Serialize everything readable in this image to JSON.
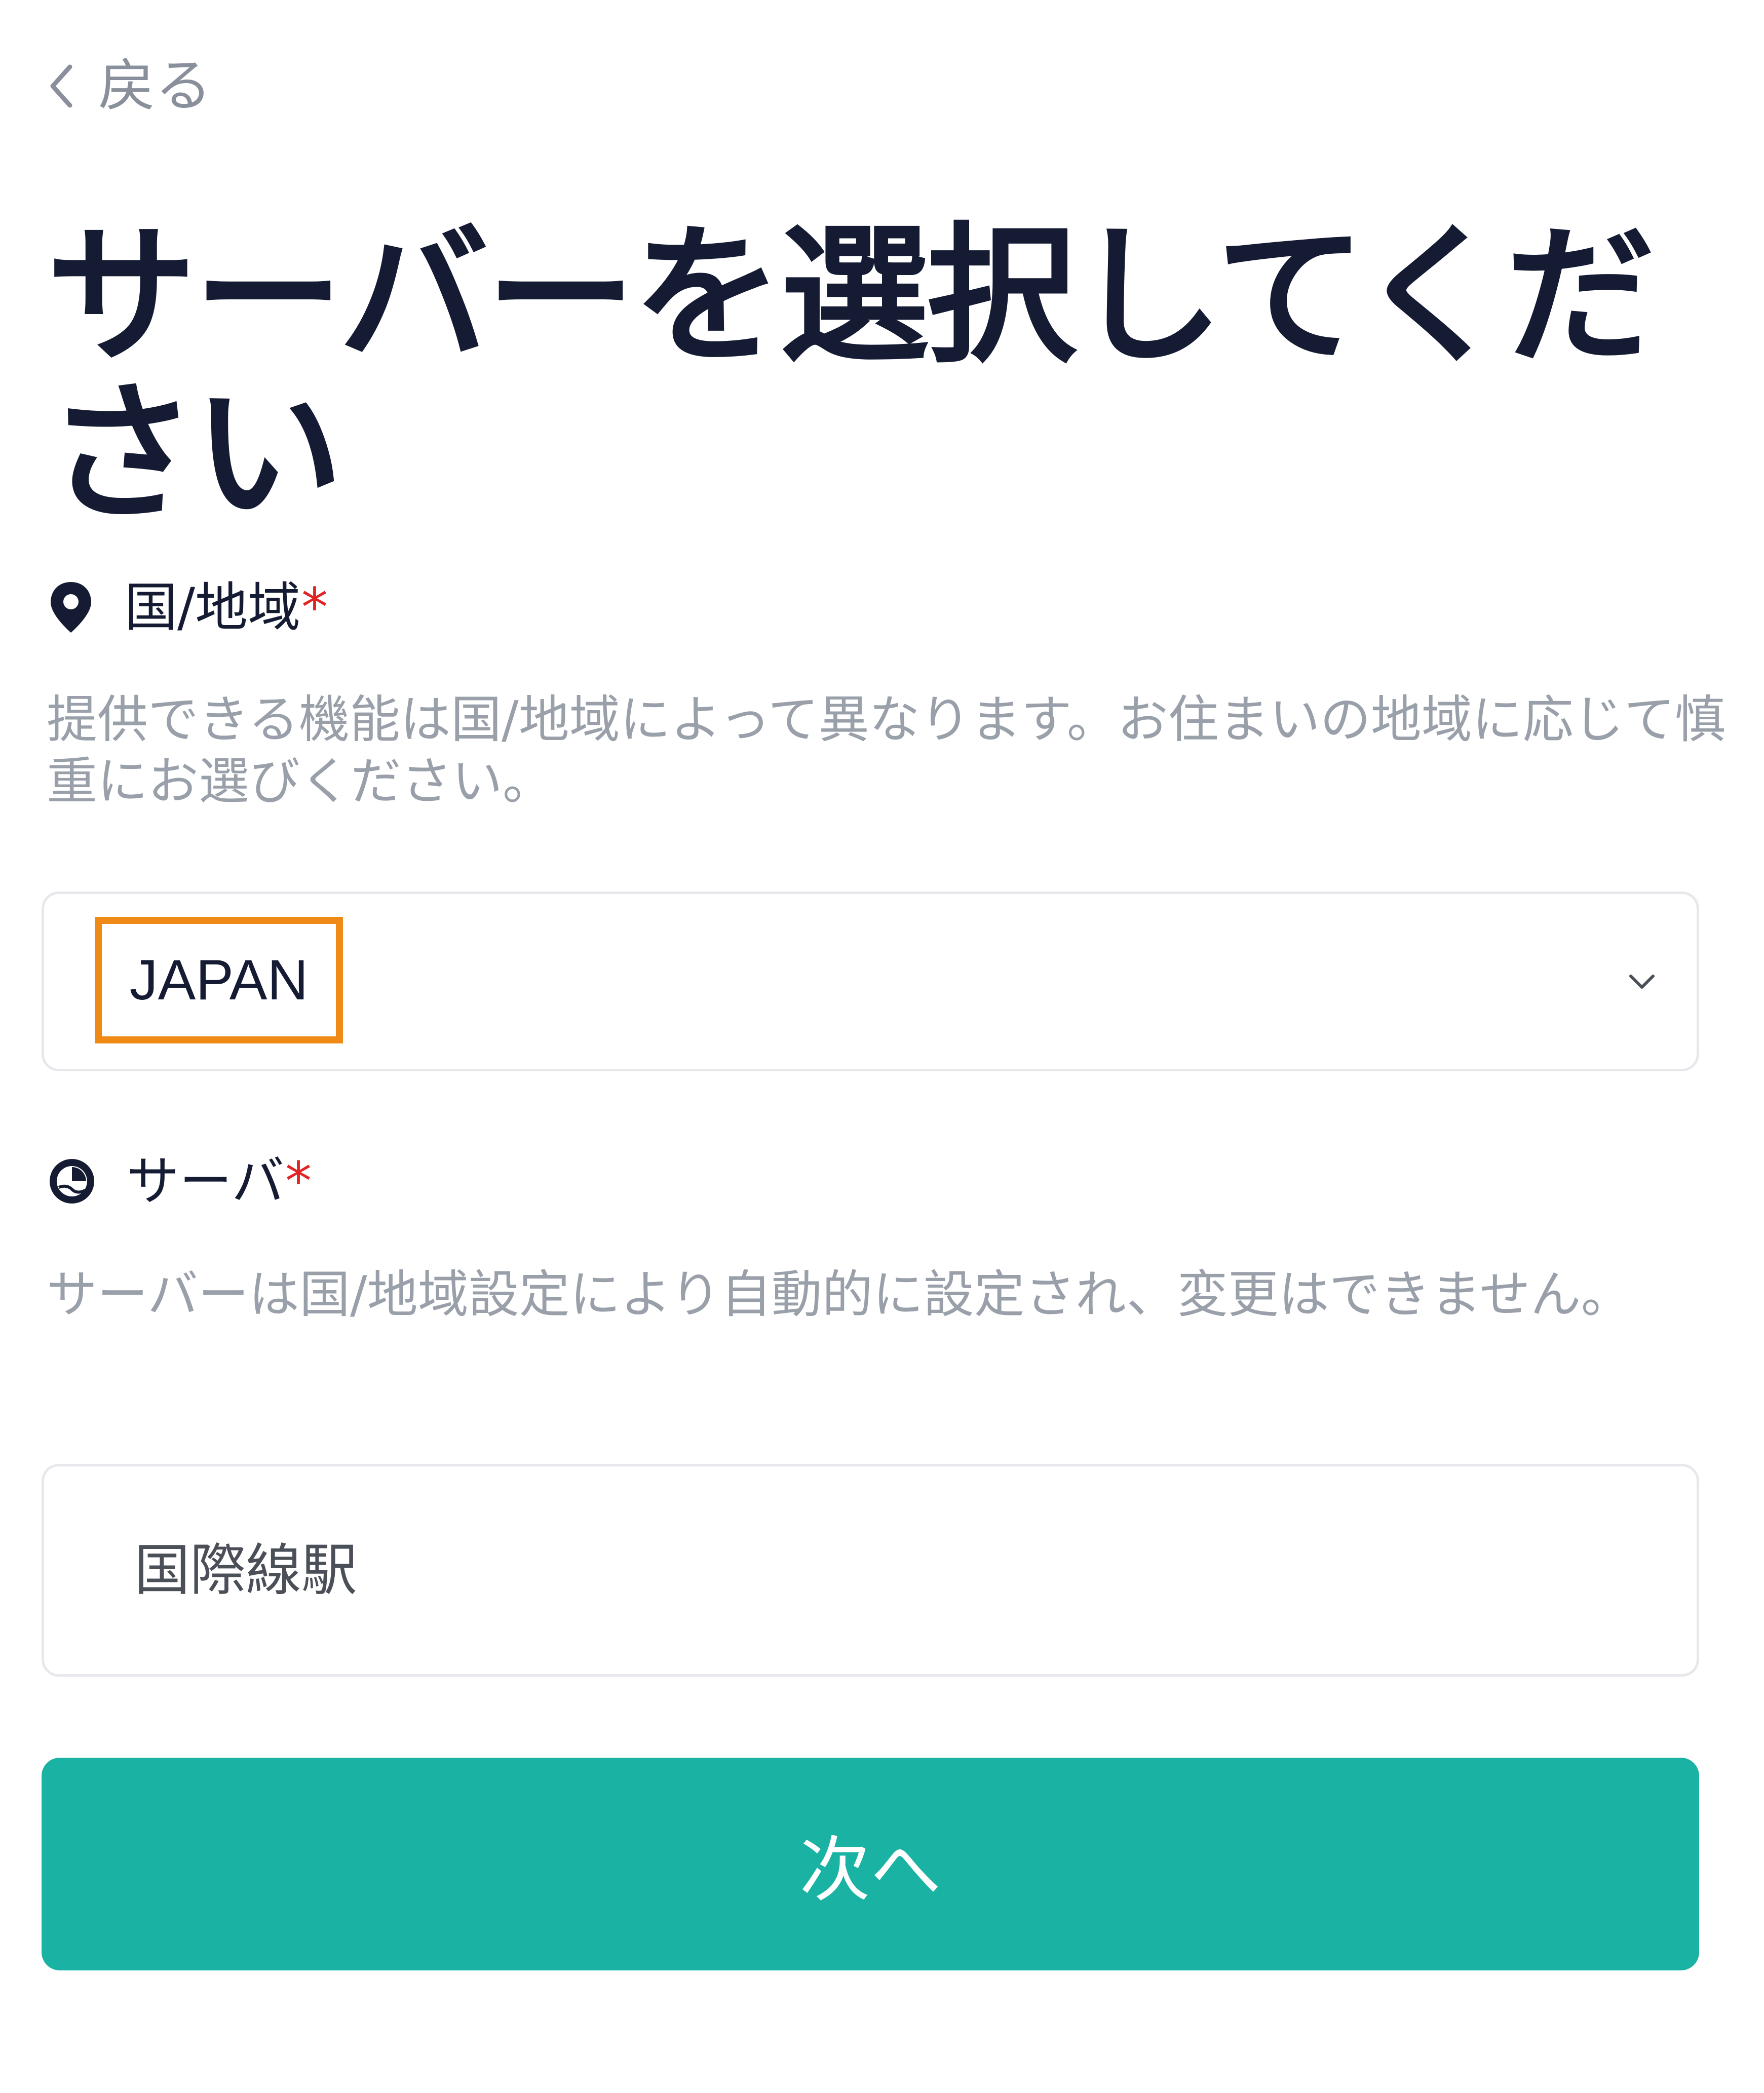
{
  "header": {
    "back_label": "戻る",
    "back_icon": "chevron-left-icon"
  },
  "page": {
    "title": "サーバーを選択してください"
  },
  "country_field": {
    "icon": "location-pin-icon",
    "label": "国/地域",
    "required_mark": "*",
    "help_text": "提供できる機能は国/地域によって異なります。お住まいの地域に応じて慎重にお選びください。",
    "selected_value": "JAPAN",
    "dropdown_icon": "chevron-down-icon",
    "highlight_color": "#f08a16"
  },
  "server_field": {
    "icon": "globe-icon",
    "label": "サーバ",
    "required_mark": "*",
    "help_text": "サーバーは国/地域設定により自動的に設定され、変更はできません。",
    "value": "国際線駅"
  },
  "actions": {
    "next_label": "次へ"
  },
  "colors": {
    "primary": "#1ab2a3",
    "required": "#e02424",
    "title": "#141b33",
    "muted": "#9aa0aa"
  }
}
